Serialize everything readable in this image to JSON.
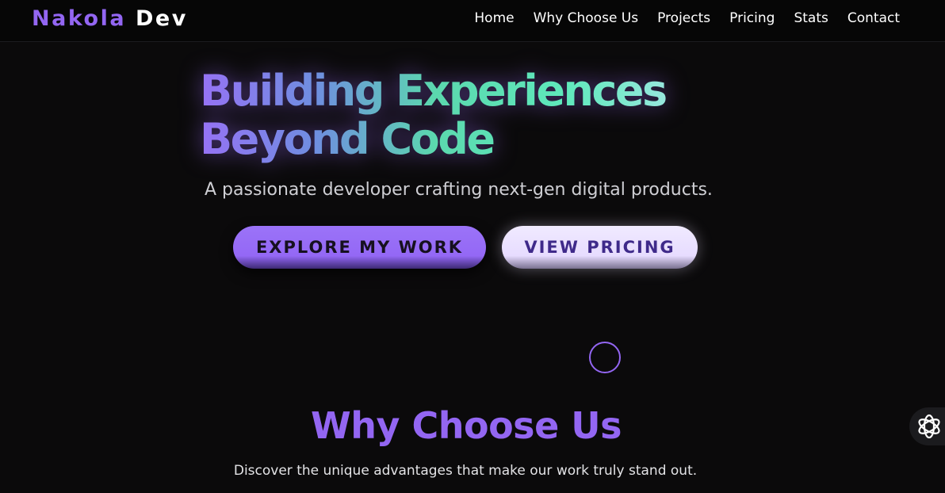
{
  "navbar": {
    "logo_part1": "Nakola",
    "logo_part2": "Dev",
    "links": [
      "Home",
      "Why Choose Us",
      "Projects",
      "Pricing",
      "Stats",
      "Contact"
    ]
  },
  "hero": {
    "title_line1": "Building Experiences",
    "title_line2": "Beyond Code",
    "subtitle": "A passionate developer crafting next-gen digital products.",
    "primary_button": "EXPLORE MY WORK",
    "secondary_button": "VIEW PRICING"
  },
  "why_section": {
    "title": "Why Choose Us",
    "subtitle": "Discover the unique advantages that make our work truly stand out."
  },
  "icons": {
    "scroll_indicator": "circle-scroll-indicator",
    "chat_widget": "openai-knot-icon"
  },
  "colors": {
    "accent": "#9366f2",
    "background": "#0b0a0b",
    "gradient_mint": "#5fe9bb",
    "secondary_button_text": "#3f2a8a"
  }
}
